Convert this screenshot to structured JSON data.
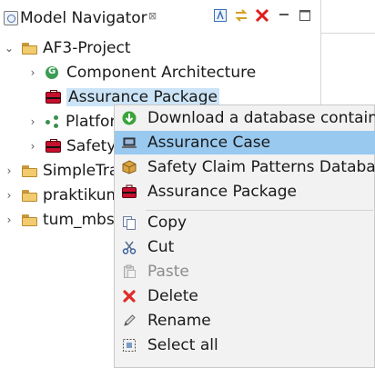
{
  "view": {
    "title": "Model Navigator",
    "close_glyph": "⊠"
  },
  "tree": {
    "project": "AF3-Project",
    "children": [
      {
        "label": "Component Architecture"
      },
      {
        "label": "Assurance Package"
      },
      {
        "label": "Platfor"
      },
      {
        "label": "Safety"
      }
    ],
    "roots": [
      {
        "label": "SimpleTra"
      },
      {
        "label": "praktikum"
      },
      {
        "label": "tum_mbse"
      }
    ]
  },
  "context_menu": {
    "items": [
      {
        "label": "Download a database containin",
        "icon": "download-icon"
      },
      {
        "label": "Assurance Case",
        "icon": "laptop-icon"
      },
      {
        "label": "Safety Claim Patterns Database",
        "icon": "package-icon"
      },
      {
        "label": "Assurance Package",
        "icon": "red-case-icon"
      },
      {
        "label": "Copy",
        "icon": "copy-icon"
      },
      {
        "label": "Cut",
        "icon": "scissors-icon"
      },
      {
        "label": "Paste",
        "icon": "paste-icon"
      },
      {
        "label": "Delete",
        "icon": "delete-icon"
      },
      {
        "label": "Rename",
        "icon": "pencil-icon"
      },
      {
        "label": "Select all",
        "icon": "select-all-icon"
      }
    ]
  },
  "colors": {
    "selection_bg": "#99c9ef",
    "tree_highlight": "#cce4f7",
    "delete_red": "#e02b2b",
    "close_red": "#e01b1b"
  }
}
